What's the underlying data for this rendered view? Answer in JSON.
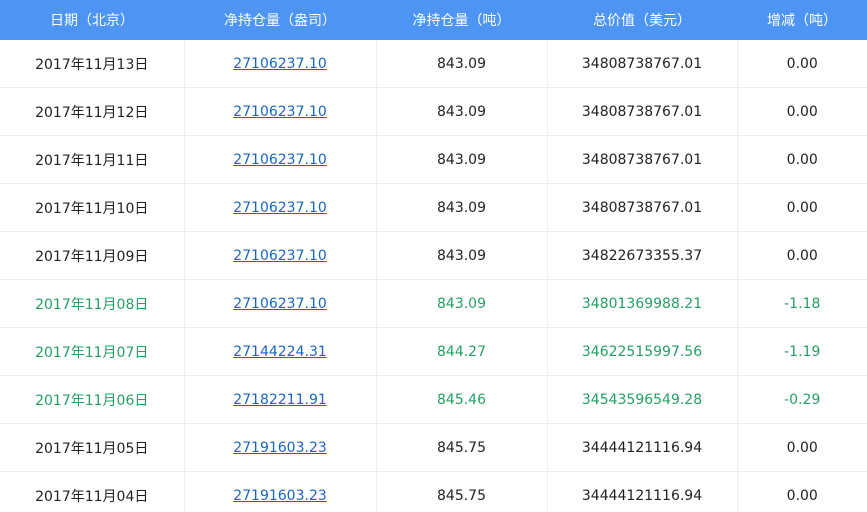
{
  "headers": [
    "日期（北京）",
    "净持仓量（盎司）",
    "净持仓量（吨）",
    "总价值（美元）",
    "增减（吨）"
  ],
  "rows": [
    {
      "date": "2017年11月13日",
      "oz": "27106237.10",
      "ton": "843.09",
      "value": "34808738767.01",
      "change": "0.00",
      "trend": "flat"
    },
    {
      "date": "2017年11月12日",
      "oz": "27106237.10",
      "ton": "843.09",
      "value": "34808738767.01",
      "change": "0.00",
      "trend": "flat"
    },
    {
      "date": "2017年11月11日",
      "oz": "27106237.10",
      "ton": "843.09",
      "value": "34808738767.01",
      "change": "0.00",
      "trend": "flat"
    },
    {
      "date": "2017年11月10日",
      "oz": "27106237.10",
      "ton": "843.09",
      "value": "34808738767.01",
      "change": "0.00",
      "trend": "flat"
    },
    {
      "date": "2017年11月09日",
      "oz": "27106237.10",
      "ton": "843.09",
      "value": "34822673355.37",
      "change": "0.00",
      "trend": "flat"
    },
    {
      "date": "2017年11月08日",
      "oz": "27106237.10",
      "ton": "843.09",
      "value": "34801369988.21",
      "change": "-1.18",
      "trend": "down"
    },
    {
      "date": "2017年11月07日",
      "oz": "27144224.31",
      "ton": "844.27",
      "value": "34622515997.56",
      "change": "-1.19",
      "trend": "down"
    },
    {
      "date": "2017年11月06日",
      "oz": "27182211.91",
      "ton": "845.46",
      "value": "34543596549.28",
      "change": "-0.29",
      "trend": "down"
    },
    {
      "date": "2017年11月05日",
      "oz": "27191603.23",
      "ton": "845.75",
      "value": "34444121116.94",
      "change": "0.00",
      "trend": "flat"
    },
    {
      "date": "2017年11月04日",
      "oz": "27191603.23",
      "ton": "845.75",
      "value": "34444121116.94",
      "change": "0.00",
      "trend": "flat"
    }
  ],
  "colors": {
    "header_bg": "#4d94f3",
    "link": "#1a66c0",
    "decrease": "#23a064",
    "text": "#222222"
  }
}
